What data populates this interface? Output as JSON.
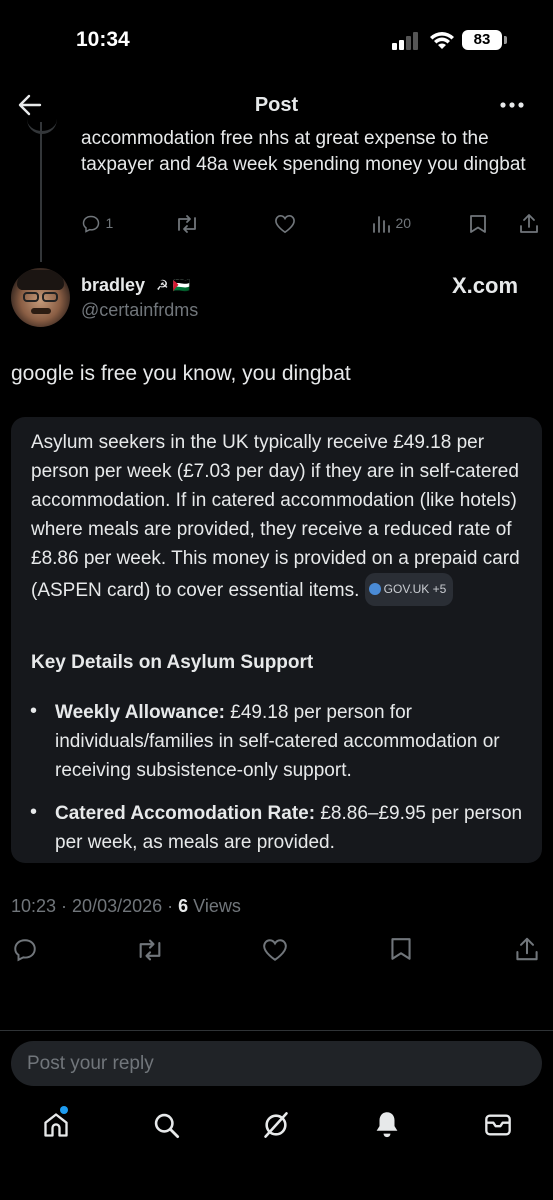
{
  "status_bar": {
    "time": "10:34",
    "battery": "83"
  },
  "header": {
    "title": "Post"
  },
  "previous_post": {
    "text": "accommodation free nhs at great expense to the taxpayer and 48a week spending money you dingbat",
    "replies": "1",
    "views": "20"
  },
  "post": {
    "author_name": "bradley",
    "author_flags": "☭ 🇵🇸",
    "handle": "@certainfrdms",
    "watermark": "X.com",
    "text": "google is free you know, you dingbat",
    "card": {
      "paragraph": "Asylum seekers in the UK typically receive £49.18 per person per week (£7.03 per day) if they are in self-catered accommodation. If in catered accommodation (like hotels) where meals are provided, they receive a reduced rate of £8.86 per week. This money is provided on a prepaid card (ASPEN card) to cover essential items.",
      "source_chip": "GOV.UK +5",
      "heading": "Key Details on Asylum Support",
      "bullets": [
        {
          "label": "Weekly Allowance:",
          "text": " £49.18 per person for individuals/families in self-catered accommodation or receiving subsistence-only support."
        },
        {
          "label": "Catered Accomodation Rate:",
          "text": " £8.86–£9.95 per person per week, as meals are provided."
        }
      ]
    },
    "timestamp": "10:23 · 20/03/2026 · ",
    "views_count": "6",
    "views_label": " Views"
  },
  "reply": {
    "placeholder": "Post your reply"
  },
  "icons": {
    "back": "arrow-left-icon",
    "more": "more-horizontal-icon",
    "reply": "speech-bubble-icon",
    "repost": "repost-icon",
    "like": "heart-icon",
    "views": "bar-chart-icon",
    "bookmark": "bookmark-icon",
    "share": "share-icon",
    "nav": [
      "home-icon",
      "search-icon",
      "grok-icon",
      "bell-icon",
      "mail-icon"
    ]
  },
  "colors": {
    "background": "#000000",
    "text": "#e7e9ea",
    "muted": "#71767b",
    "accent": "#1d9bf0",
    "card": "#16181c"
  }
}
